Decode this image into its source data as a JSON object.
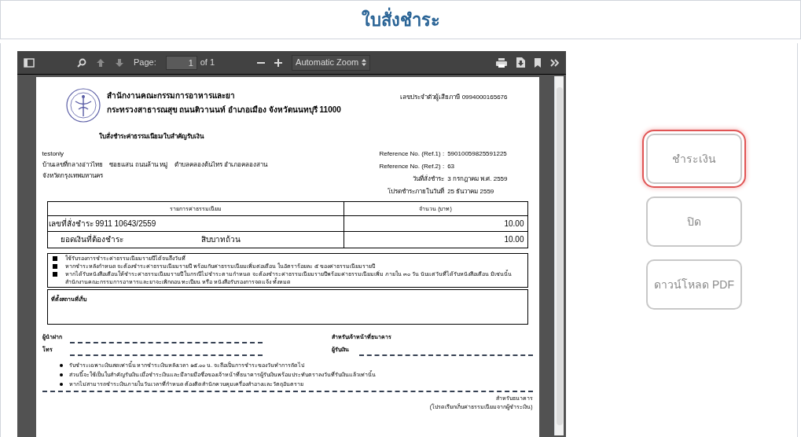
{
  "header": {
    "title": "ใบสั่งชำระ"
  },
  "viewer": {
    "toolbar": {
      "page_label": "Page:",
      "page_input": "1",
      "page_count": "of 1",
      "zoom": "Automatic Zoom"
    }
  },
  "document": {
    "agency_name": "สำนักงานคณะกรรมการอาหารและยา",
    "agency_address": "กระทรวงสาธารณสุข ถนนติวานนท์ อำเภอเมือง จังหวัดนนทบุรี 11000",
    "tax_id": "เลขประจำตัวผู้เสียภาษี 0994000165676",
    "form_title": "ใบสั่งชำระค่าธรรมเนียม/ใบสำคัญรับเงิน",
    "payer_name": "testonly",
    "payer_address": [
      "บ้านเลขที่กลางอ่าวไทย    ซอยแสน ถนนล้าน หมู่    ตำบลคลองต้นไทร อำเภอคลองสาน",
      "จังหวัดกรุงเทพมหานคร"
    ],
    "refs": [
      {
        "label": "Reference No. (Ref.1) :",
        "value": "59010059825591225"
      },
      {
        "label": "Reference No. (Ref.2) :",
        "value": "63"
      },
      {
        "label": "วันที่สั่งชำระ",
        "value": "3 กรกฎาคม พ.ศ. 2559"
      },
      {
        "label": "โปรดชำระภายในวันที่",
        "value": "25  ธันวาคม  2559"
      }
    ],
    "table": {
      "columns": [
        "รายการค่าธรรมเนียม",
        "จำนวน (บาท)"
      ],
      "rows": [
        {
          "kind": "item",
          "label": "เลขที่สั่งชำระ 9911 10643/2559",
          "amount": "10.00"
        },
        {
          "kind": "total",
          "label": "ยอดเงินที่ต้องชำระ",
          "words": "สิบบาทถ้วน",
          "amount": "10.00"
        }
      ]
    },
    "notes": [
      "ใช้รับรองการชำระค่าธรรมเนียมรายปีได้จนถึงวันที่",
      "หากชำระหลังกำหนด จะต้องชำระค่าธรรมเนียมรายปี พร้อมกับค่าธรรมเนียมเพิ่มต่อเดือน ในอัตราร้อยละ ๕ ของค่าธรรมเนียมรายปี",
      "หากได้รับหนังสือเตือนให้ชำระค่าธรรมเนียมรายปี ในกรณีไม่ชำระตามกำหนด จะต้องชำระค่าธรรมเนียมรายปีพร้อมค่าธรรมเนียมเพิ่ม ภายใน ๓๐ วัน นับแต่วันที่ได้รับหนังสือเตือน มิเช่นนั้นสำนักงานคณะกรรมการอาหารและยาจะเพิกถอน ทะเบียน หรือ หนังสือรับรองการจดแจ้ง ทั้งหมด"
    ],
    "storage_label": "ที่ตั้งสถานที่เก็บ",
    "signatures": {
      "left": [
        "ผู้นำฝาก",
        "โทร"
      ],
      "right_title": "สำหรับเจ้าหน้าที่ธนาคาร",
      "right": [
        "ผู้รับเงิน"
      ]
    },
    "bullets": [
      "รับชำระเฉพาะเงินสดเท่านั้น หากชำระเงินหลังเวลา ๑๕.๐๐ น. จะถือเป็นการชำระของวันทำการถัดไป",
      "ส่วนนี้จะใช้เป็นใบสำคัญรับเงิน เมื่อชำระเงินและมีลายมือชื่อของเจ้าหน้าที่ธนาคารผู้รับเงินพร้อมประทับตราลงวันที่รับเงินแล้วเท่านั้น",
      "หากไม่สามารถชำระเงินภายในวันเวลาที่กำหนด ต้องติดสำนักควบคุมเครื่องสำอางและวัตถุอันตราย"
    ],
    "footer": [
      "สำหรับธนาคาร",
      "(โปรดเรียกเก็บค่าธรรมเนียมจากผู้ชำระเงิน)"
    ]
  },
  "buttons": [
    {
      "label": "ชำระเงิน",
      "focused": true
    },
    {
      "label": "ปิด",
      "focused": false
    },
    {
      "label": "ดาวน์โหลด PDF",
      "focused": false
    }
  ]
}
